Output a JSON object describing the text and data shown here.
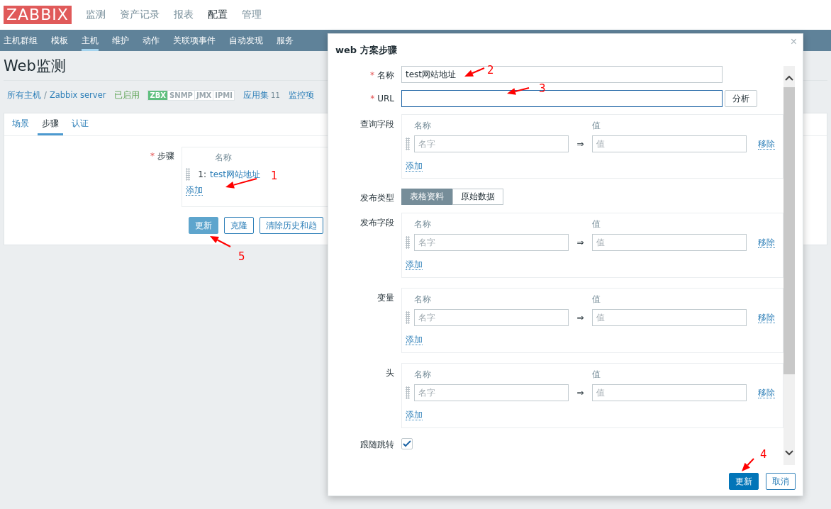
{
  "header": {
    "logo": "ZABBIX",
    "menu": [
      {
        "label": "监测",
        "selected": false
      },
      {
        "label": "资产记录",
        "selected": false
      },
      {
        "label": "报表",
        "selected": false
      },
      {
        "label": "配置",
        "selected": true
      },
      {
        "label": "管理",
        "selected": false
      }
    ]
  },
  "submenu": [
    {
      "label": "主机群组",
      "selected": false
    },
    {
      "label": "模板",
      "selected": false
    },
    {
      "label": "主机",
      "selected": true
    },
    {
      "label": "维护",
      "selected": false
    },
    {
      "label": "动作",
      "selected": false
    },
    {
      "label": "关联项事件",
      "selected": false
    },
    {
      "label": "自动发现",
      "selected": false
    },
    {
      "label": "服务",
      "selected": false
    }
  ],
  "page_title": "Web监测",
  "breadcrumb": {
    "items": [
      "所有主机",
      "Zabbix server"
    ],
    "separator": "/",
    "status": "已启用",
    "availability": [
      {
        "label": "ZBX",
        "active": true
      },
      {
        "label": "SNMP",
        "active": false
      },
      {
        "label": "JMX",
        "active": false
      },
      {
        "label": "IPMI",
        "active": false
      }
    ],
    "links": [
      {
        "label": "应用集",
        "count": "11"
      },
      {
        "label": "监控项"
      }
    ]
  },
  "tabs": [
    {
      "label": "场景",
      "selected": false
    },
    {
      "label": "步骤",
      "selected": true
    },
    {
      "label": "认证",
      "selected": false
    }
  ],
  "steps": {
    "label": "步骤",
    "required_mark": "*",
    "column": "名称",
    "rows": [
      {
        "index": "1:",
        "name": "test网站地址"
      }
    ],
    "add": "添加"
  },
  "actions": [
    {
      "label": "更新",
      "primary": true
    },
    {
      "label": "克隆",
      "primary": false
    },
    {
      "label": "清除历史和趋",
      "primary": false
    }
  ],
  "dialog": {
    "title": "web 方案步骤",
    "close": "×",
    "fields": [
      {
        "label": "名称",
        "required_mark": "*",
        "value": "test网站地址",
        "focused": false
      },
      {
        "label": "URL",
        "required_mark": "*",
        "focused": true,
        "button": "分析"
      }
    ],
    "sections": [
      {
        "kind": "pairs",
        "label": "查询字段",
        "columns": [
          "名称",
          "值"
        ],
        "rows": [
          {
            "name_placeholder": "名字",
            "value_placeholder": "值",
            "arrow": "⇒",
            "remove": "移除"
          }
        ],
        "add": "添加"
      },
      {
        "kind": "segmented",
        "label": "发布类型",
        "options": [
          {
            "label": "表格资料",
            "selected": true
          },
          {
            "label": "原始数据",
            "selected": false
          }
        ]
      },
      {
        "kind": "pairs",
        "label": "发布字段",
        "columns": [
          "名称",
          "值"
        ],
        "rows": [
          {
            "name_placeholder": "名字",
            "value_placeholder": "值",
            "arrow": "⇒",
            "remove": "移除"
          }
        ],
        "add": "添加"
      },
      {
        "kind": "pairs",
        "label": "变量",
        "columns": [
          "名称",
          "值"
        ],
        "rows": [
          {
            "name_placeholder": "名字",
            "value_placeholder": "值",
            "arrow": "⇒",
            "remove": "移除"
          }
        ],
        "add": "添加"
      },
      {
        "kind": "pairs",
        "label": "头",
        "columns": [
          "名称",
          "值"
        ],
        "rows": [
          {
            "name_placeholder": "名字",
            "value_placeholder": "值",
            "arrow": "⇒",
            "remove": "移除"
          }
        ],
        "add": "添加"
      },
      {
        "kind": "checkbox",
        "label": "跟随跳转",
        "checked": true
      }
    ],
    "buttons": [
      {
        "label": "更新",
        "primary": true
      },
      {
        "label": "取消",
        "primary": false
      }
    ]
  },
  "annotations": [
    {
      "label": "1"
    },
    {
      "label": "2"
    },
    {
      "label": "3"
    },
    {
      "label": "4"
    },
    {
      "label": "5"
    }
  ]
}
